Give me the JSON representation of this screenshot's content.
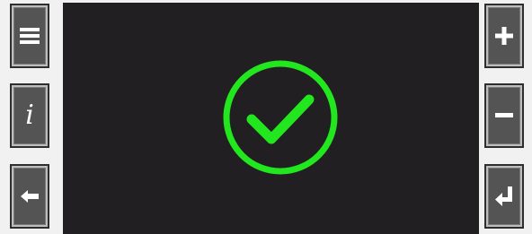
{
  "buttons": {
    "menu": {
      "icon": "menu-icon"
    },
    "info": {
      "icon": "info-icon",
      "glyph": "i"
    },
    "back": {
      "icon": "arrow-left-icon"
    },
    "plus": {
      "icon": "plus-icon"
    },
    "minus": {
      "icon": "minus-icon"
    },
    "enter": {
      "icon": "enter-icon"
    }
  },
  "screen": {
    "status_icon": "checkmark-circle-icon",
    "status_color": "#22e61e",
    "background_color": "#211f22"
  }
}
